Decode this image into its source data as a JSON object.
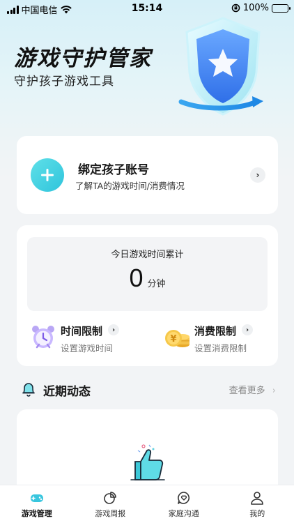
{
  "status_bar": {
    "carrier": "中国电信",
    "time": "15:14",
    "battery": "100%"
  },
  "hero": {
    "title": "游戏守护管家",
    "subtitle": "守护孩子游戏工具"
  },
  "bind": {
    "title": "绑定孩子账号",
    "description": "了解TA的游戏时间/消费情况"
  },
  "today": {
    "label": "今日游戏时间累计",
    "value": "0",
    "unit": "分钟"
  },
  "limits": [
    {
      "title": "时间限制",
      "description": "设置游戏时间",
      "icon": "alarm-clock-icon"
    },
    {
      "title": "消费限制",
      "description": "设置消费限制",
      "icon": "coins-icon"
    }
  ],
  "recent": {
    "title": "近期动态",
    "more": "查看更多"
  },
  "tabs": [
    {
      "label": "游戏管理",
      "icon": "gamepad-icon",
      "active": true
    },
    {
      "label": "游戏周报",
      "icon": "pie-chart-icon",
      "active": false
    },
    {
      "label": "家庭沟通",
      "icon": "heart-chat-icon",
      "active": false
    },
    {
      "label": "我的",
      "icon": "user-icon",
      "active": false
    }
  ],
  "colors": {
    "accent": "#2fc4dc",
    "background": "#f2f4f6",
    "battery": "#34c759"
  }
}
